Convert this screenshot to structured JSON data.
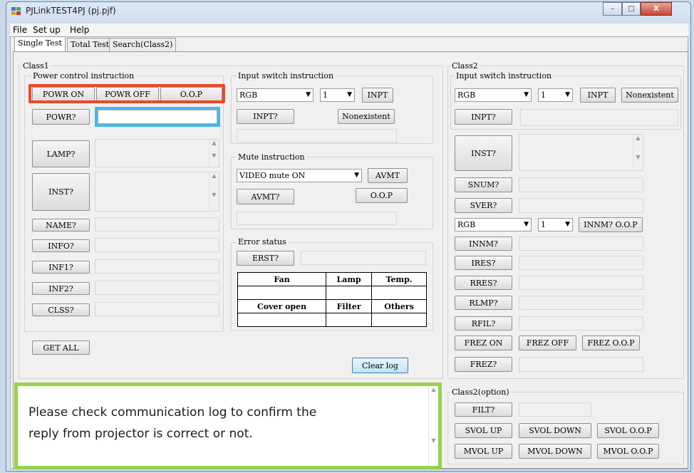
{
  "window": {
    "title": "PJLinkTEST4PJ (pj.pjf)",
    "min_label": "–",
    "max_label": "□",
    "close_label": "X"
  },
  "menu": [
    "File",
    "Set up",
    "Help"
  ],
  "tabs": [
    "Single Test",
    "Total Test",
    "Search(Class2)"
  ],
  "class1": {
    "title": "Class1",
    "power": {
      "title": "Power control instruction",
      "powr_on": "POWR ON",
      "powr_off": "POWR OFF",
      "oop": "O.O.P",
      "powr_q": "POWR?"
    },
    "lamp_q": "LAMP?",
    "inst_q": "INST?",
    "name_q": "NAME?",
    "info_q": "INFO?",
    "inf1_q": "INF1?",
    "inf2_q": "INF2?",
    "clss_q": "CLSS?",
    "get_all": "GET ALL"
  },
  "input_switch": {
    "title": "Input switch instruction",
    "source": "RGB",
    "number": "1",
    "inpt": "INPT",
    "inpt_q": "INPT?",
    "nonexistent": "Nonexistent"
  },
  "mute": {
    "title": "Mute instruction",
    "mode": "VIDEO mute ON",
    "avmt": "AVMT",
    "avmt_q": "AVMT?",
    "oop": "O.O.P"
  },
  "error": {
    "title": "Error status",
    "erst_q": "ERST?",
    "headers1": [
      "Fan",
      "Lamp",
      "Temp."
    ],
    "headers2": [
      "Cover open",
      "Filter",
      "Others"
    ]
  },
  "clear_log": "Clear log",
  "class2": {
    "title": "Class2",
    "input_title": "Input switch instruction",
    "source": "RGB",
    "number": "1",
    "inpt": "INPT",
    "nonexistent": "Nonexistent",
    "inpt_q": "INPT?",
    "inst_q": "INST?",
    "snum_q": "SNUM?",
    "sver_q": "SVER?",
    "innm_source": "RGB",
    "innm_number": "1",
    "innm_oop": "INNM? O.O.P",
    "innm_q": "INNM?",
    "ires_q": "IRES?",
    "rres_q": "RRES?",
    "rlmp_q": "RLMP?",
    "rfil_q": "RFIL?",
    "frez_on": "FREZ ON",
    "frez_off": "FREZ OFF",
    "frez_oop": "FREZ O.O.P",
    "frez_q": "FREZ?"
  },
  "class2_option": {
    "title": "Class2(option)",
    "filt_q": "FILT?",
    "svol_up": "SVOL UP",
    "svol_down": "SVOL DOWN",
    "svol_oop": "SVOL O.O.P",
    "mvol_up": "MVOL UP",
    "mvol_down": "MVOL DOWN",
    "mvol_oop": "MVOL O.O.P"
  },
  "note": {
    "line1": "Please check communication log to confirm the",
    "line2": "reply from projector is correct or not."
  },
  "colors": {
    "highlight_red": "#e8492b",
    "highlight_blue": "#4ab6e9",
    "highlight_green": "#96d24c"
  }
}
